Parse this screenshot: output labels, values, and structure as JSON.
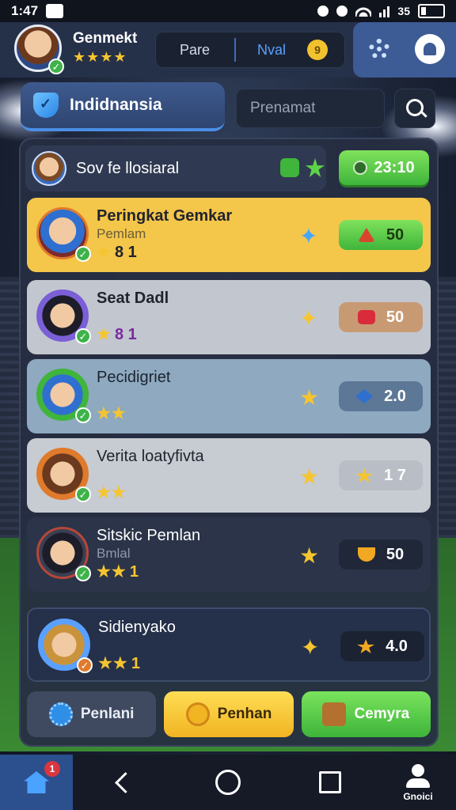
{
  "status_bar": {
    "time": "1:47",
    "battery": "35"
  },
  "header": {
    "username": "Genmekt",
    "user_stars": "★★★★",
    "segment_left": "Pare",
    "segment_right": "Nval",
    "coin_label": "9"
  },
  "search": {
    "region_label": "Indidnansia",
    "placeholder": "Prenamat"
  },
  "top_row": {
    "name": "Sov fe llosiaral",
    "badge_value": "23:10"
  },
  "leaderboard": [
    {
      "name": "Peringkat Gemkar",
      "sub": "Pemlam",
      "stars": "★",
      "rating_num": "8 1",
      "score": "50"
    },
    {
      "name": "Seat Dadl",
      "sub": "",
      "stars": "★",
      "rating_num": "8 1",
      "score": "50"
    },
    {
      "name": "Pecidigriet",
      "sub": "",
      "stars": "★★",
      "rating_num": "",
      "score": "2.0"
    },
    {
      "name": "Verita loatyfivta",
      "sub": "",
      "stars": "★★",
      "rating_num": "",
      "score": "1 7"
    },
    {
      "name": "Sitskic Pemlan",
      "sub": "Bmlal",
      "stars": "★★",
      "rating_num": "1",
      "score": "50"
    },
    {
      "name": "Sidienyako",
      "sub": "",
      "stars": "★★",
      "rating_num": "1",
      "score": "4.0"
    }
  ],
  "bottom_buttons": {
    "b1": "Penlani",
    "b2": "Penhan",
    "b3": "Cemyra"
  },
  "navbar": {
    "home_badge": "1",
    "account_label": "Gnoici"
  },
  "colors": {
    "accent": "#4a8fe6",
    "gold": "#f5c531",
    "green": "#3fb53b"
  },
  "icons": [
    "shield-icon",
    "search-icon",
    "gear-icon",
    "profile-icon",
    "home-icon",
    "back-icon",
    "home-circle-icon",
    "recents-icon",
    "account-icon"
  ]
}
